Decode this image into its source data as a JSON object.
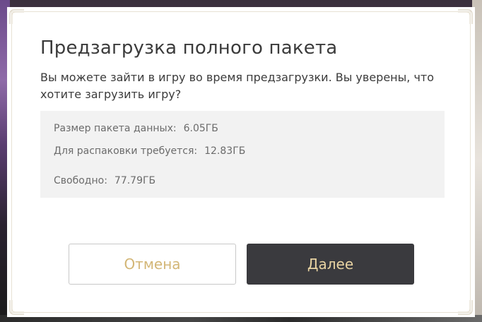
{
  "dialog": {
    "title": "Предзагрузка полного пакета",
    "description": "Вы можете зайти в игру во время предзагрузки. Вы уверены, что хотите загрузить игру?",
    "info": {
      "package_size_label": "Размер пакета данных:",
      "package_size_value": "6.05ГБ",
      "unpack_label": "Для распаковки требуется:",
      "unpack_value": "12.83ГБ",
      "free_label": "Свободно:",
      "free_value": "77.79ГБ"
    },
    "buttons": {
      "cancel_label": "Отмена",
      "next_label": "Далее"
    }
  },
  "colors": {
    "accent_gold": "#d3b676",
    "primary_button_bg": "#3a3a3e",
    "primary_button_text": "#e8d3a2",
    "info_bg": "#f2f2f2"
  },
  "icons": [
    "corner-ornament-icon"
  ]
}
